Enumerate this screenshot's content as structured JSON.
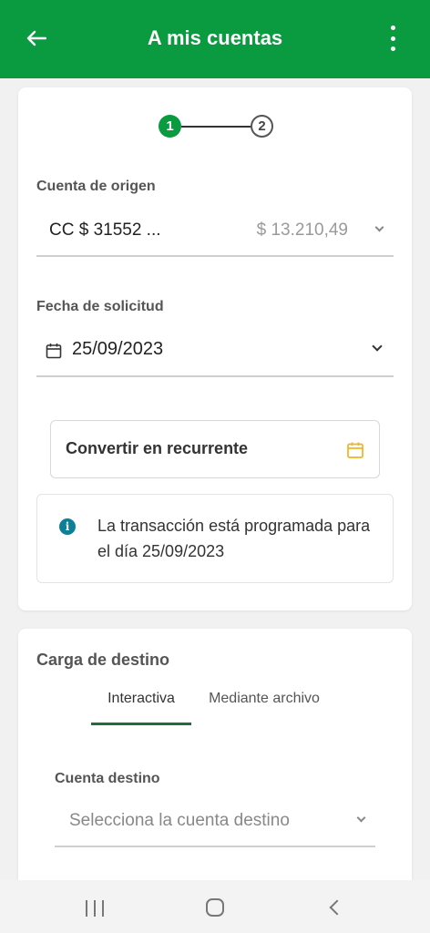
{
  "header": {
    "title": "A mis cuentas",
    "back_icon": "arrow-left-icon",
    "menu_icon": "more-vertical-icon"
  },
  "stepper": {
    "steps": [
      "1",
      "2"
    ],
    "current": 1,
    "active_color": "#0a9a3f"
  },
  "origin": {
    "label": "Cuenta de origen",
    "account": "CC $ 31552  ...",
    "balance": "$ 13.210,49"
  },
  "request_date": {
    "label": "Fecha de solicitud",
    "value": "25/09/2023"
  },
  "recurring": {
    "label": "Convertir en recurrente",
    "icon_color": "#f0b323"
  },
  "info": {
    "text": "La transacción está programada para el día 25/09/2023",
    "icon_color": "#0d7f96"
  },
  "destination": {
    "title": "Carga de destino",
    "tabs": [
      {
        "label": "Interactiva",
        "active": true
      },
      {
        "label": "Mediante archivo",
        "active": false
      }
    ],
    "account_label": "Cuenta destino",
    "account_placeholder": "Selecciona la cuenta destino"
  },
  "colors": {
    "brand": "#0a9a3f",
    "tab_indicator": "#1d6f3a"
  }
}
